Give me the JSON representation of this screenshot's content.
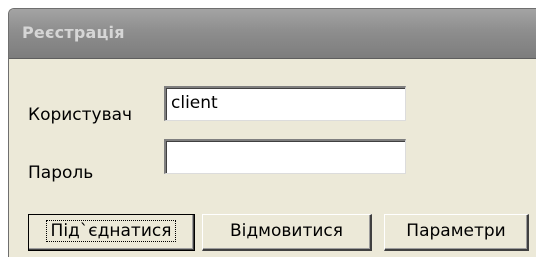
{
  "window": {
    "title": "Реєстрація"
  },
  "form": {
    "user_label": "Користувач",
    "user_value": "client",
    "password_label": "Пароль",
    "password_value": ""
  },
  "buttons": {
    "connect": "Під`єднатися",
    "cancel": "Відмовитися",
    "settings": "Параметри"
  }
}
